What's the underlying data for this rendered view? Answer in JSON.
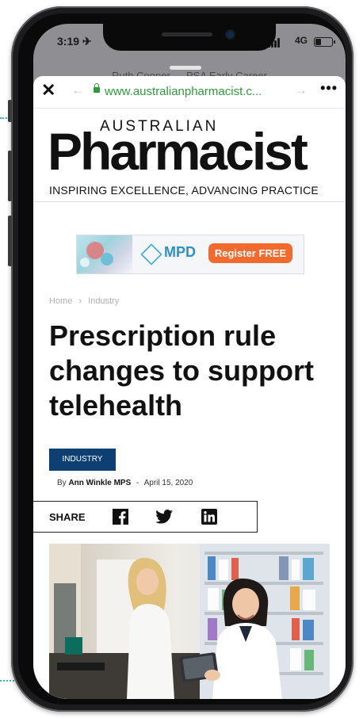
{
  "status_bar": {
    "time": "3:19 ✈",
    "network": "4G"
  },
  "background_tab": {
    "title": "Ruth Cooper — PSA Early Career"
  },
  "browser": {
    "url": "www.australianpharmacist.c...",
    "close": "✕",
    "back": "←",
    "forward": "→",
    "more": "•••"
  },
  "masthead": {
    "brand_top": "AUSTRALIAN",
    "brand_main": "Pharmacist",
    "tagline": "INSPIRING EXCELLENCE, ADVANCING PRACTICE"
  },
  "ad": {
    "logo": "MPD",
    "cta": "Register FREE"
  },
  "breadcrumb": {
    "home": "Home",
    "separator": "›",
    "section": "Industry"
  },
  "article": {
    "title": "Prescription rule changes to support telehealth",
    "category": "INDUSTRY",
    "by": "By",
    "author": "Ann Winkle MPS",
    "dash": "-",
    "date": "April 15, 2020"
  },
  "share": {
    "label": "SHARE",
    "icons": [
      "facebook-icon",
      "twitter-icon",
      "linkedin-icon"
    ]
  },
  "colors": {
    "url_green": "#2e9b3a",
    "category_blue": "#0d3f73",
    "cta_orange": "#f26a2e",
    "mpd_blue": "#2f8fc6"
  }
}
